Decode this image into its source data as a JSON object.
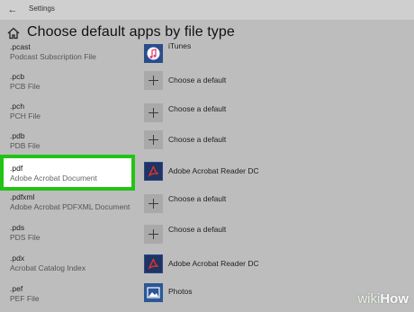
{
  "window": {
    "title": "Settings"
  },
  "page": {
    "title": "Choose default apps by file type"
  },
  "rows": [
    {
      "ext": ".pcast",
      "desc": "Podcast Subscription File",
      "app": "iTunes",
      "icon": "itunes-icon"
    },
    {
      "ext": ".pcb",
      "desc": "PCB File",
      "app": "Choose a default",
      "icon": "plus-icon"
    },
    {
      "ext": ".pch",
      "desc": "PCH File",
      "app": "Choose a default",
      "icon": "plus-icon"
    },
    {
      "ext": ".pdb",
      "desc": "PDB File",
      "app": "Choose a default",
      "icon": "plus-icon"
    },
    {
      "ext": ".pdf",
      "desc": "Adobe Acrobat Document",
      "app": "Adobe Acrobat Reader DC",
      "icon": "acrobat-icon",
      "highlighted": true
    },
    {
      "ext": ".pdfxml",
      "desc": "Adobe Acrobat PDFXML Document",
      "app": "Choose a default",
      "icon": "plus-icon"
    },
    {
      "ext": ".pds",
      "desc": "PDS File",
      "app": "Choose a default",
      "icon": "plus-icon"
    },
    {
      "ext": ".pdx",
      "desc": "Acrobat Catalog Index",
      "app": "Adobe Acrobat Reader DC",
      "icon": "acrobat-icon"
    },
    {
      "ext": ".pef",
      "desc": "PEF File",
      "app": "Photos",
      "icon": "photos-icon"
    }
  ],
  "colors": {
    "background": "#bdbdbd",
    "highlight_border": "#23c316",
    "acrobat_tile": "#1f3464",
    "plus_tile": "#a9a9a9"
  },
  "watermark": {
    "prefix": "wiki",
    "suffix": "How"
  }
}
